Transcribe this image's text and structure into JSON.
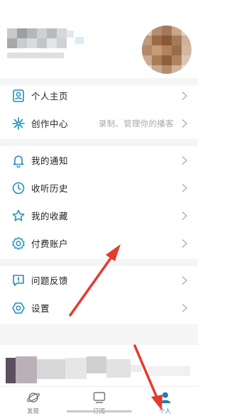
{
  "menu": {
    "group1": [
      {
        "label": "个人主页",
        "icon": "person-card-icon",
        "hint": ""
      },
      {
        "label": "创作中心",
        "icon": "sparkle-icon",
        "hint": "录制、管理你的播客"
      }
    ],
    "group2": [
      {
        "label": "我的通知",
        "icon": "bell-icon"
      },
      {
        "label": "收听历史",
        "icon": "clock-icon"
      },
      {
        "label": "我的收藏",
        "icon": "star-icon"
      },
      {
        "label": "付费账户",
        "icon": "gear-badge-icon"
      }
    ],
    "group3": [
      {
        "label": "问题反馈",
        "icon": "feedback-icon"
      },
      {
        "label": "设置",
        "icon": "settings-icon"
      }
    ]
  },
  "tabbar": {
    "items": [
      {
        "label": "发现",
        "icon": "planet-icon"
      },
      {
        "label": "订阅",
        "icon": "tv-icon"
      },
      {
        "label": "个人",
        "icon": "user-icon"
      }
    ],
    "active": "个人"
  },
  "colors": {
    "accent": "#1e8fb8",
    "annotation_arrow": "#e53a2e",
    "separator": "#f4f5f7"
  }
}
